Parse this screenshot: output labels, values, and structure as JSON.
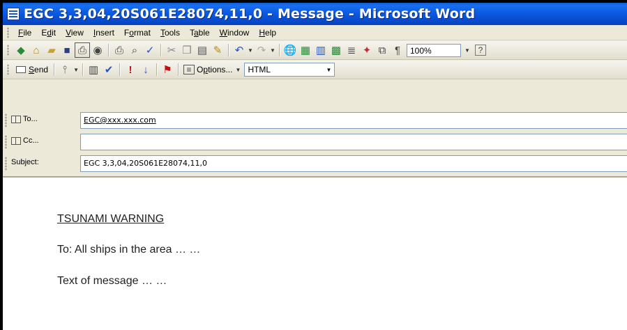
{
  "window": {
    "title": "EGC 3,3,04,20S061E28074,11,0 - Message - Microsoft Word"
  },
  "menu": [
    {
      "mnemonic": "F",
      "rest": "ile"
    },
    {
      "pre": "E",
      "mnemonic": "d",
      "rest": "it"
    },
    {
      "mnemonic": "V",
      "rest": "iew"
    },
    {
      "mnemonic": "I",
      "rest": "nsert"
    },
    {
      "pre": "F",
      "mnemonic": "o",
      "rest": "rmat"
    },
    {
      "mnemonic": "T",
      "rest": "ools"
    },
    {
      "pre": "T",
      "mnemonic": "a",
      "rest": "ble"
    },
    {
      "mnemonic": "W",
      "rest": "indow"
    },
    {
      "mnemonic": "H",
      "rest": "elp"
    }
  ],
  "toolbar_standard": {
    "zoom": "100%",
    "help_glyph": "?"
  },
  "toolbar_email": {
    "send_mnemonic": "S",
    "send_rest": "end",
    "options_pre": "O",
    "options_mnemonic": "p",
    "options_rest": "tions...",
    "format_value": "HTML"
  },
  "header": {
    "to_label": "To...",
    "to_value": "EGC@xxx.xxx.com",
    "cc_label": "Cc...",
    "cc_value": "",
    "subject_label": "Subject:",
    "subject_value": "EGC 3,3,04,20S061E28074,11,0"
  },
  "body": {
    "title": "TSUNAMI WARNING",
    "to_line": "To: All ships in the area … …",
    "text_line": "Text of message … …"
  }
}
